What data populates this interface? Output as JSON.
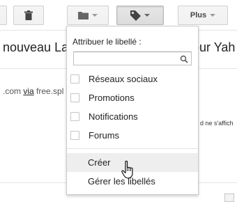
{
  "toolbar": {
    "more_label": "Plus",
    "icons": [
      "trash-icon",
      "folder-icon",
      "label-tag-icon"
    ]
  },
  "email": {
    "title_left": "nouveau La",
    "title_right": "our Yah",
    "meta_prefix": ".com ",
    "meta_via": "via",
    "meta_sender": " free.spl",
    "notice": "d ne s'affich"
  },
  "label_menu": {
    "heading": "Attribuer le libellé :",
    "search_value": "",
    "search_placeholder": "",
    "labels": [
      {
        "label": "Réseaux sociaux",
        "checked": false
      },
      {
        "label": "Promotions",
        "checked": false
      },
      {
        "label": "Notifications",
        "checked": false
      },
      {
        "label": "Forums",
        "checked": false
      }
    ],
    "actions": [
      {
        "label": "Créer",
        "hovered": true
      },
      {
        "label": "Gérer les libellés",
        "hovered": false
      }
    ]
  },
  "colors": {
    "hover_bg": "#eeeeee",
    "button_bg": "#f5f5f5",
    "icon_gray": "#444444"
  }
}
